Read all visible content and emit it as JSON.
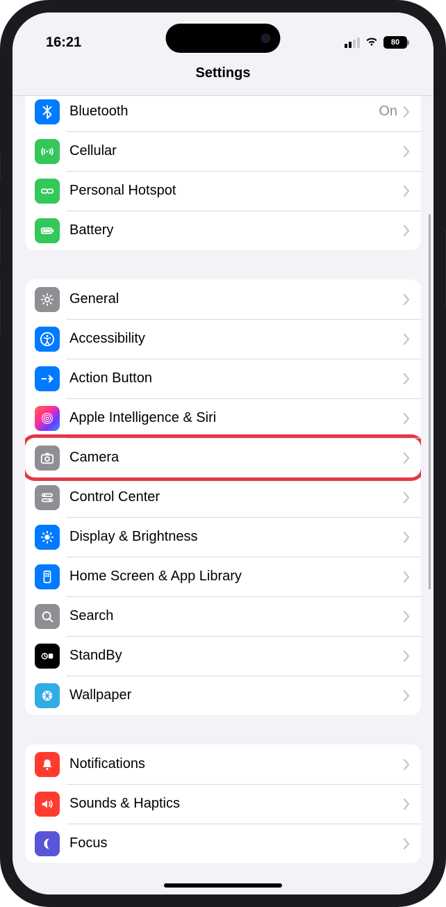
{
  "status": {
    "time": "16:21",
    "battery_percent": "80"
  },
  "nav": {
    "title": "Settings"
  },
  "groups": [
    {
      "id": "connectivity",
      "first": true,
      "rows": [
        {
          "id": "bluetooth",
          "label": "Bluetooth",
          "value": "On",
          "icon": "bluetooth-icon",
          "color": "ic-blue"
        },
        {
          "id": "cellular",
          "label": "Cellular",
          "icon": "cellular-icon",
          "color": "ic-green"
        },
        {
          "id": "personal-hotspot",
          "label": "Personal Hotspot",
          "icon": "hotspot-icon",
          "color": "ic-green"
        },
        {
          "id": "battery",
          "label": "Battery",
          "icon": "battery-icon",
          "color": "ic-green"
        }
      ]
    },
    {
      "id": "system",
      "rows": [
        {
          "id": "general",
          "label": "General",
          "icon": "gear-icon",
          "color": "ic-gray"
        },
        {
          "id": "accessibility",
          "label": "Accessibility",
          "icon": "accessibility-icon",
          "color": "ic-blue"
        },
        {
          "id": "action-button",
          "label": "Action Button",
          "icon": "action-button-icon",
          "color": "ic-blue"
        },
        {
          "id": "apple-intelligence-siri",
          "label": "Apple Intelligence & Siri",
          "icon": "siri-icon",
          "color": "ic-gradient"
        },
        {
          "id": "camera",
          "label": "Camera",
          "icon": "camera-icon",
          "color": "ic-gray",
          "highlighted": true
        },
        {
          "id": "control-center",
          "label": "Control Center",
          "icon": "control-center-icon",
          "color": "ic-gray"
        },
        {
          "id": "display-brightness",
          "label": "Display & Brightness",
          "icon": "brightness-icon",
          "color": "ic-blue"
        },
        {
          "id": "home-screen",
          "label": "Home Screen & App Library",
          "icon": "home-screen-icon",
          "color": "ic-blue"
        },
        {
          "id": "search",
          "label": "Search",
          "icon": "search-icon",
          "color": "ic-gray"
        },
        {
          "id": "standby",
          "label": "StandBy",
          "icon": "standby-icon",
          "color": "ic-black"
        },
        {
          "id": "wallpaper",
          "label": "Wallpaper",
          "icon": "wallpaper-icon",
          "color": "ic-cyan"
        }
      ]
    },
    {
      "id": "notifications",
      "rows": [
        {
          "id": "notifications",
          "label": "Notifications",
          "icon": "notifications-icon",
          "color": "ic-red"
        },
        {
          "id": "sounds-haptics",
          "label": "Sounds & Haptics",
          "icon": "sounds-icon",
          "color": "ic-red"
        },
        {
          "id": "focus",
          "label": "Focus",
          "icon": "focus-icon",
          "color": "ic-purple"
        }
      ]
    }
  ]
}
